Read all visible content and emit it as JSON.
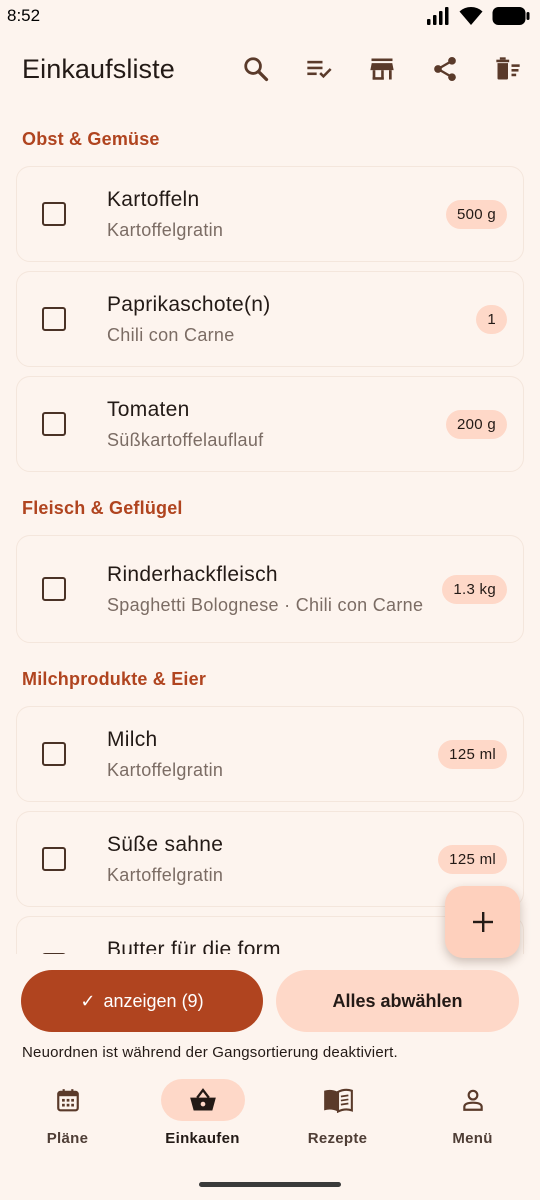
{
  "status_bar": {
    "time": "8:52"
  },
  "app_bar": {
    "title": "Einkaufsliste",
    "actions": [
      "search-icon",
      "checklist-icon",
      "store-icon",
      "share-icon",
      "delete-sweep-icon"
    ]
  },
  "sections": [
    {
      "title": "Obst & Gemüse",
      "items": [
        {
          "name": "Kartoffeln",
          "recipes": "Kartoffelgratin",
          "quantity": "500 g"
        },
        {
          "name": "Paprikaschote(n)",
          "recipes": "Chili con Carne",
          "quantity": "1"
        },
        {
          "name": "Tomaten",
          "recipes": "Süßkartoffelauflauf",
          "quantity": "200 g"
        }
      ]
    },
    {
      "title": "Fleisch & Geflügel",
      "items": [
        {
          "name": "Rinderhackfleisch",
          "recipes": "Spaghetti Bolognese · Chili con Carne",
          "quantity": "1.3 kg"
        }
      ]
    },
    {
      "title": "Milchprodukte & Eier",
      "items": [
        {
          "name": "Milch",
          "recipes": "Kartoffelgratin",
          "quantity": "125 ml"
        },
        {
          "name": "Süße sahne",
          "recipes": "Kartoffelgratin",
          "quantity": "125 ml"
        },
        {
          "name": "Butter für die form",
          "recipes": "",
          "quantity": ""
        }
      ]
    }
  ],
  "actions": {
    "show_checked_label": "anzeigen (9)",
    "show_checked_prefix": "✓",
    "deselect_all_label": "Alles abwählen"
  },
  "notice": "Neuordnen ist während der Gangsortierung deaktiviert.",
  "nav": {
    "items": [
      {
        "label": "Pläne",
        "icon": "calendar-icon",
        "active": false
      },
      {
        "label": "Einkaufen",
        "icon": "basket-icon",
        "active": true
      },
      {
        "label": "Rezepte",
        "icon": "book-icon",
        "active": false
      },
      {
        "label": "Menü",
        "icon": "person-icon",
        "active": false
      }
    ]
  },
  "colors": {
    "accent": "#b0441f",
    "pill": "#fed8c8",
    "background": "#fdf4ee",
    "icon": "#5a3a2a"
  }
}
